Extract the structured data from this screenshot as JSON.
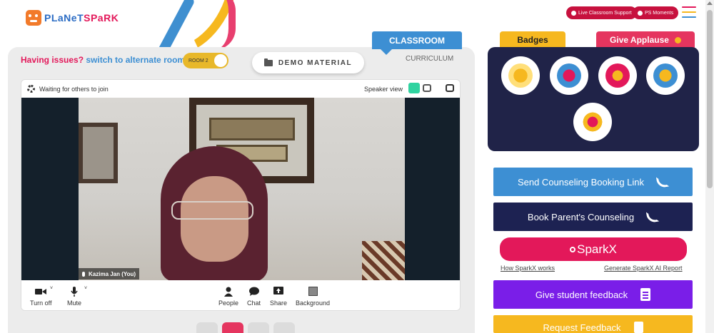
{
  "header": {
    "logo_planet": "PLaNeT",
    "logo_spark": "SPaRK",
    "live_support_label": "Live Classroom Support",
    "ps_moments_label": "PS Moments"
  },
  "tabs": {
    "classroom": "CLASSROOM",
    "curriculum": "CURRICULUM"
  },
  "toolbar": {
    "issues_question": "Having issues?",
    "issues_link": "switch to alternate room",
    "room_label": "ROOM 2",
    "demo_material": "DEMO MATERIAL"
  },
  "meeting": {
    "status": "Waiting for others to join",
    "view_mode": "Speaker view",
    "participant_name": "Kazima Jan (You)",
    "controls": {
      "turn_off": "Turn off",
      "mute": "Mute",
      "people": "People",
      "chat": "Chat",
      "share": "Share",
      "background": "Background"
    }
  },
  "sidebar": {
    "badges_tab": "Badges",
    "applause_tab": "Give Applause",
    "send_counseling": "Send Counseling Booking Link",
    "book_counseling": "Book Parent's Counseling",
    "sparkx": "SparkX",
    "how_sparkx": "How SparkX works",
    "generate_report": "Generate SparkX AI Report",
    "give_feedback": "Give student feedback",
    "request_feedback": "Request Feedback"
  },
  "colors": {
    "brand_pink": "#e3185a",
    "brand_blue": "#3d8fd3",
    "navy": "#202348",
    "purple": "#7a1ee8",
    "yellow": "#f6b81f"
  }
}
